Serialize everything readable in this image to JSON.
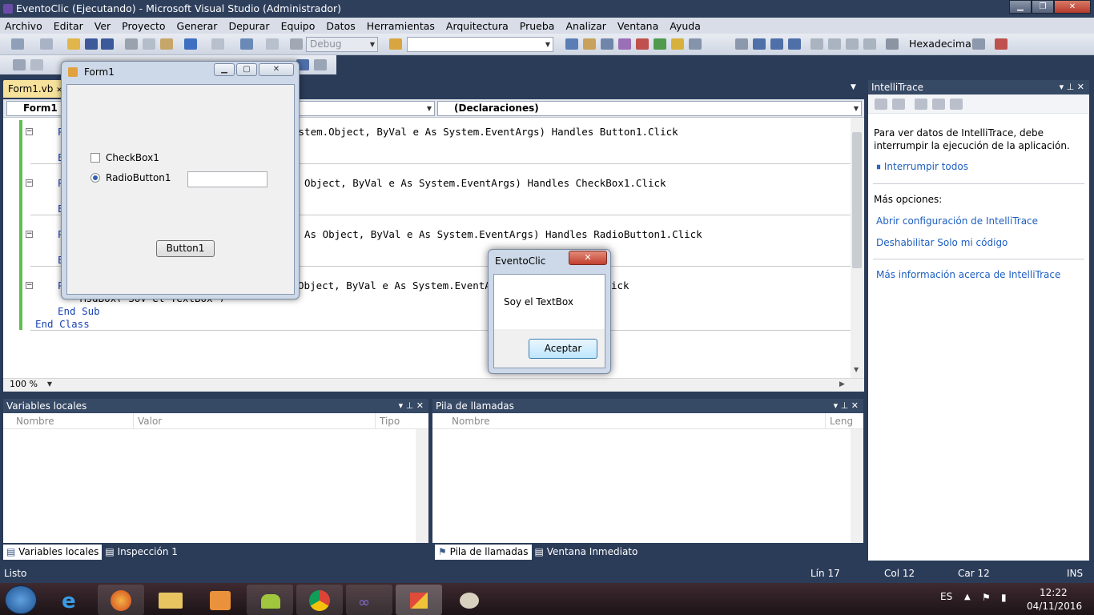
{
  "window": {
    "title": "EventoClic (Ejecutando) - Microsoft Visual Studio (Administrador)"
  },
  "menu": [
    "Archivo",
    "Editar",
    "Ver",
    "Proyecto",
    "Generar",
    "Depurar",
    "Equipo",
    "Datos",
    "Herramientas",
    "Arquitectura",
    "Prueba",
    "Analizar",
    "Ventana",
    "Ayuda"
  ],
  "toolbar": {
    "config": "Debug",
    "platform": "",
    "hex_label": "Hexadecimal"
  },
  "document_tab": {
    "label": "Form1.vb"
  },
  "editor": {
    "class_combo": "Form1",
    "member_combo": "(Declaraciones)",
    "zoom": "100 %",
    "lines": {
      "l1": {
        "a": "ystem.Object, ByVal e As System.EventArgs) Handles Button1.Click"
      },
      "l2": {
        "a": "Object, ByVal e As System.EventArgs) Handles CheckBox1.Click"
      },
      "l3": {
        "a": "As Object, ByVal e As System.EventArgs) Handles RadioButton1.Click"
      },
      "l4": {
        "a": "Object, ByVal e As System.EventArgs) Handles TextBox1.Click"
      },
      "msgbox": "MsgBox(\"Soy el TextBox\")",
      "end_sub": "End Sub",
      "end_class": "End Class"
    }
  },
  "form1": {
    "title": "Form1",
    "checkbox": "CheckBox1",
    "radio": "RadioButton1",
    "button": "Button1"
  },
  "msgbox": {
    "title": "EventoClic",
    "message": "Soy el TextBox",
    "ok": "Aceptar"
  },
  "intellitrace": {
    "title": "IntelliTrace",
    "info": "Para ver datos de IntelliTrace, debe interrumpir la ejecución de la aplicación.",
    "break_all": "Interrumpir todos",
    "more_options": "Más opciones:",
    "config_link": "Abrir configuración de IntelliTrace",
    "disable_link": "Deshabilitar Solo mi código",
    "more_info_link": "Más información acerca de IntelliTrace"
  },
  "locals": {
    "title": "Variables locales",
    "cols": [
      "Nombre",
      "Valor",
      "Tipo"
    ],
    "tab1": "Variables locales",
    "tab2": "Inspección 1"
  },
  "callstack": {
    "title": "Pila de llamadas",
    "cols": [
      "Nombre",
      "Leng"
    ],
    "tab1": "Pila de llamadas",
    "tab2": "Ventana Inmediato"
  },
  "status": {
    "left": "Listo",
    "line": "Lín 17",
    "col": "Col 12",
    "char": "Car 12",
    "ins": "INS"
  },
  "taskbar": {
    "lang": "ES",
    "time": "12:22",
    "date": "04/11/2016"
  }
}
